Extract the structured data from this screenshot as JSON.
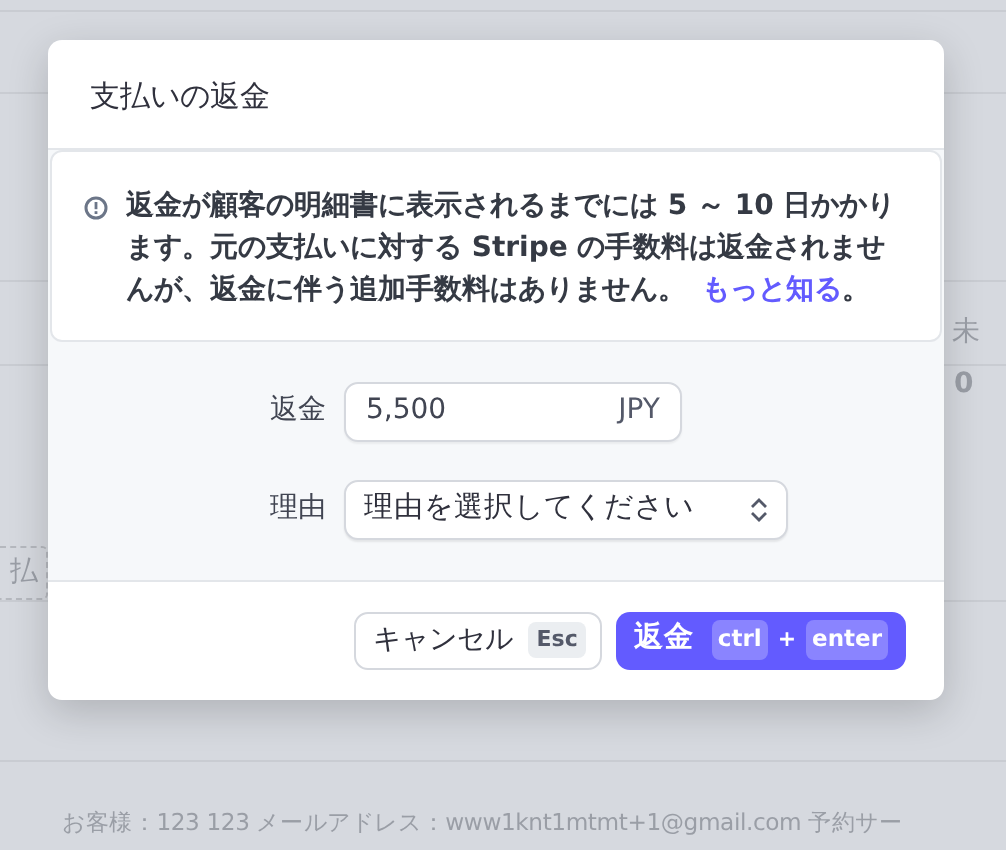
{
  "background": {
    "texts": [
      {
        "kind": "tag",
        "text": "払"
      },
      {
        "kind": "right",
        "text": "未"
      },
      {
        "kind": "count",
        "text": "0"
      },
      {
        "kind": "line",
        "text": "お客様：123 123 メールアドレス：www1knt1mtmt+1@gmail.com 予約サー"
      }
    ]
  },
  "dialog": {
    "title": "支払いの返金",
    "notice": {
      "text": "返金が顧客の明細書に表示されるまでには 5 ～ 10 日かかります。元の支払いに対する Stripe の手数料は返金されませんが、返金に伴う追加手数料はありません。",
      "link": "もっと知る",
      "tail": "。"
    },
    "fields": [
      {
        "kind": "amount",
        "label": "返金",
        "value": "5,500",
        "suffix": "JPY"
      },
      {
        "kind": "select",
        "label": "理由",
        "value": "理由を選択してください"
      }
    ],
    "buttons": [
      {
        "kind": "secondary",
        "label": "キャンセル",
        "keys": [
          "Esc"
        ]
      },
      {
        "kind": "primary",
        "label": "返金",
        "keys": [
          "ctrl",
          "+",
          "enter"
        ]
      }
    ]
  }
}
